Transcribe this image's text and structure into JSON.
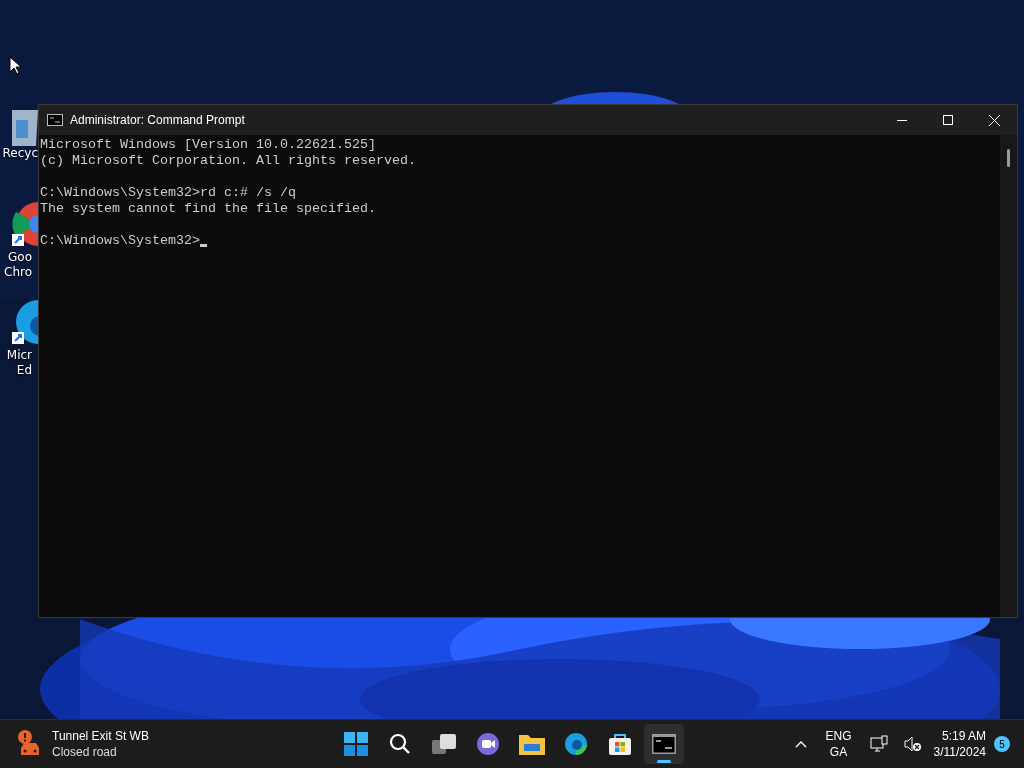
{
  "desktop_icons": [
    {
      "kind": "recycle",
      "label_lines": [
        "Recyc"
      ]
    },
    {
      "kind": "chrome",
      "label_lines": [
        "Goo",
        "Chro"
      ]
    },
    {
      "kind": "edge",
      "label_lines": [
        "Micr",
        "Ed"
      ]
    }
  ],
  "window": {
    "title": "Administrator: Command Prompt",
    "console_blocks": [
      [
        "Microsoft Windows [Version 10.0.22621.525]",
        "(c) Microsoft Corporation. All rights reserved."
      ],
      [
        "C:\\Windows\\System32>rd c:# /s /q",
        "The system cannot find the file specified."
      ],
      [
        "C:\\Windows\\System32>"
      ]
    ]
  },
  "taskbar": {
    "widget": {
      "title": "Tunnel Exit St WB",
      "subtitle": "Closed road"
    },
    "apps": [
      {
        "kind": "start",
        "selected": false
      },
      {
        "kind": "search",
        "selected": false
      },
      {
        "kind": "taskview",
        "selected": false
      },
      {
        "kind": "chat",
        "selected": false
      },
      {
        "kind": "explorer",
        "selected": false
      },
      {
        "kind": "edge",
        "selected": false
      },
      {
        "kind": "store",
        "selected": false
      },
      {
        "kind": "terminal",
        "selected": true
      }
    ],
    "language": [
      "ENG",
      "GA"
    ],
    "time": "5:19 AM",
    "date": "3/11/2024",
    "notification_count": "5"
  }
}
